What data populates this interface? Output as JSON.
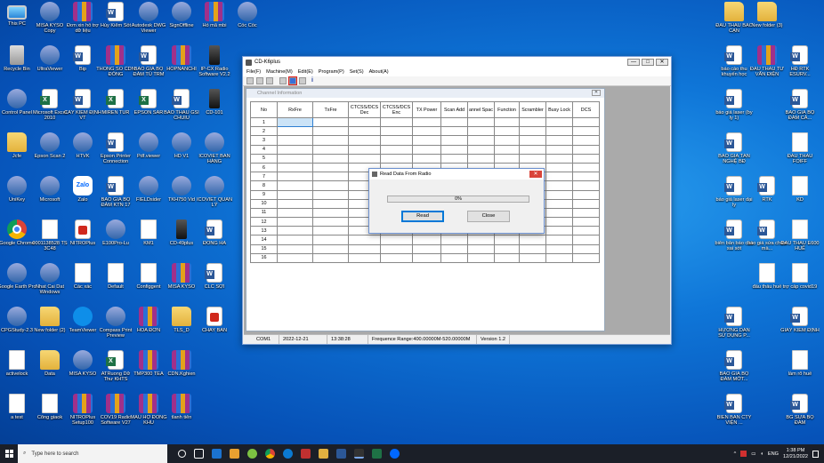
{
  "desktop": {
    "left_icons": [
      [
        {
          "label": "This PC",
          "type": "pc"
        },
        {
          "label": "Recycle Bin",
          "type": "bin"
        },
        {
          "label": "Control Panel",
          "type": "app"
        },
        {
          "label": "Jcfe",
          "type": "folder"
        },
        {
          "label": "UniKey",
          "type": "app"
        },
        {
          "label": "Google Chrome",
          "type": "chrome"
        },
        {
          "label": "Google Earth Pro",
          "type": "app"
        },
        {
          "label": "CPGStudy-2.3",
          "type": "app"
        },
        {
          "label": "activelock",
          "type": "doc"
        },
        {
          "label": "a test",
          "type": "doc"
        }
      ],
      [
        {
          "label": "MISA KYSO Copy",
          "type": "app"
        },
        {
          "label": "UltraViewer",
          "type": "app"
        },
        {
          "label": "Microsoft Excel 2010",
          "type": "excel"
        },
        {
          "label": "Epson Scan 2",
          "type": "app"
        },
        {
          "label": "Microsoft",
          "type": "app"
        },
        {
          "label": "0001138528 TS 3C48",
          "type": "doc"
        },
        {
          "label": "Nhat Cai Dat Windows",
          "type": "app"
        },
        {
          "label": "New folder (2)",
          "type": "folder"
        },
        {
          "label": "Data",
          "type": "folder"
        },
        {
          "label": "Cổng giaok",
          "type": "doc"
        }
      ],
      [
        {
          "label": "Đơn xin hỗ trợ dữ liệu",
          "type": "rar"
        },
        {
          "label": "Bip",
          "type": "word"
        },
        {
          "label": "CÁY KIỂM ĐỊNH VT",
          "type": "word"
        },
        {
          "label": "HTVK",
          "type": "app"
        },
        {
          "label": "Zalo",
          "type": "zalo"
        },
        {
          "label": "NITROPlus",
          "type": "pdf"
        },
        {
          "label": "Các xác",
          "type": "doc"
        },
        {
          "label": "TeamViewer",
          "type": "teamviewer"
        },
        {
          "label": "MISA KYSO",
          "type": "app"
        },
        {
          "label": "NITROPlus Setup100",
          "type": "rar"
        }
      ],
      [
        {
          "label": "Hủy Kiểm Sốt",
          "type": "word"
        },
        {
          "label": "THÔNG SỐ CDN ĐÓNG",
          "type": "rar"
        },
        {
          "label": "MIREN TUR",
          "type": "excel"
        },
        {
          "label": "Epson Printer Connection",
          "type": "word"
        },
        {
          "label": "BẢO GIÁ BỘ ĐÀM KTN 17",
          "type": "word"
        },
        {
          "label": "E100Pro-Lu",
          "type": "app"
        },
        {
          "label": "Default",
          "type": "doc"
        },
        {
          "label": "Compass Print Preview",
          "type": "app"
        },
        {
          "label": "ATRuong Dữ Thư KHTS",
          "type": "excel"
        },
        {
          "label": "COV19 Radio Software V27",
          "type": "rar"
        }
      ],
      [
        {
          "label": "Autodesk DWG Viewer",
          "type": "app"
        },
        {
          "label": "BẢO GIÁ BỘ ĐÀM TÙ TRM",
          "type": "word"
        },
        {
          "label": "EPSON SAR",
          "type": "excel"
        },
        {
          "label": "Pdf.viewer",
          "type": "app"
        },
        {
          "label": "FIELDsider",
          "type": "app"
        },
        {
          "label": "KM1",
          "type": "doc"
        },
        {
          "label": "Configgent",
          "type": "doc"
        },
        {
          "label": "HOA ĐƠN",
          "type": "rar"
        },
        {
          "label": "TMP300 TEA",
          "type": "rar"
        },
        {
          "label": "MẪU HỢ ĐỒNG KHU",
          "type": "rar"
        }
      ],
      [
        {
          "label": "SignOffline",
          "type": "app"
        },
        {
          "label": "HOPNANCHI",
          "type": "rar"
        },
        {
          "label": "BẢO THẦU GSI CHUIU",
          "type": "word"
        },
        {
          "label": "HD V1",
          "type": "app"
        },
        {
          "label": "TKH750 Vid",
          "type": "app"
        },
        {
          "label": "CD-49plus",
          "type": "radio"
        },
        {
          "label": "MISA KYSO",
          "type": "rar"
        },
        {
          "label": "TLS_D",
          "type": "folder"
        },
        {
          "label": "CDN.Kghien",
          "type": "rar"
        },
        {
          "label": "tlanh tiên",
          "type": "rar"
        }
      ],
      [
        {
          "label": "Hỏ mã mbi",
          "type": "rar"
        },
        {
          "label": "IP-CX Radio Software V2.2",
          "type": "radio"
        },
        {
          "label": "CD-101",
          "type": "radio"
        },
        {
          "label": "ICOVIET BẢN HÀNG",
          "type": "app"
        },
        {
          "label": "ICOVIET QUẢN LÝ",
          "type": "app"
        },
        {
          "label": "ĐỒNG HÀ",
          "type": "word"
        },
        {
          "label": "CLC SỢI",
          "type": "word"
        },
        {
          "label": "CHAY BẢN",
          "type": "pdf"
        },
        {
          "label": "",
          "type": "none"
        },
        {
          "label": "",
          "type": "none"
        }
      ],
      [
        {
          "label": "Cốc Cốc",
          "type": "app"
        }
      ]
    ],
    "right_icons": [
      [
        {
          "label": "ĐẦU THẦU BẮC CẠN",
          "type": "folder"
        },
        {
          "label": "báo cáo thu khuyến học",
          "type": "word"
        },
        {
          "label": "báo giá laser (by ly 1)",
          "type": "word"
        },
        {
          "label": "BẢO GIÁ TÂN NGHỆ BĐ",
          "type": "word"
        },
        {
          "label": "báo giá laser dại ly",
          "type": "word"
        },
        {
          "label": "biên bản báo cáo sai sót",
          "type": "word"
        },
        {
          "label": "",
          "type": "none"
        },
        {
          "label": "HƯỚNG DẪN SỬ DỤNG P...",
          "type": "word"
        },
        {
          "label": "BÁO GIÁ BỘ ĐÀM MỚT...",
          "type": "word"
        },
        {
          "label": "BIÊN BẢN CTY VIỆN ...",
          "type": "word"
        }
      ],
      [
        {
          "label": "New folder (3)",
          "type": "folder"
        },
        {
          "label": "ĐẦU THẦU TƯ VẤN ĐIỆN",
          "type": "rar"
        },
        {
          "label": "",
          "type": "none"
        },
        {
          "label": "",
          "type": "none"
        },
        {
          "label": "RTK",
          "type": "word"
        },
        {
          "label": "báo giá sửa chữa mà...",
          "type": "word"
        },
        {
          "label": "đấu thầu huế",
          "type": "doc"
        },
        {
          "label": "",
          "type": "none"
        },
        {
          "label": "",
          "type": "none"
        },
        {
          "label": "",
          "type": "none"
        }
      ],
      [
        {
          "label": "",
          "type": "none"
        },
        {
          "label": "HĐ RTK ESURV...",
          "type": "word"
        },
        {
          "label": "BÁO GIÁ BỘ ĐÀM CẢ...",
          "type": "word"
        },
        {
          "label": "ĐẤU THẦU FOIFF",
          "type": "doc"
        },
        {
          "label": "KD",
          "type": "doc"
        },
        {
          "label": "ĐẤU THẦU E600 HUẾ",
          "type": "doc"
        },
        {
          "label": "trợ cấp covid19",
          "type": "doc"
        },
        {
          "label": "GIẤY KIỂM ĐỊNH",
          "type": "word"
        },
        {
          "label": "làm rõ huế",
          "type": "doc"
        },
        {
          "label": "BG SỬA BỘ ĐÀM",
          "type": "word"
        }
      ]
    ]
  },
  "app": {
    "title": "CD-K6plus",
    "menu": [
      "File(F)",
      "Machine(M)",
      "Edit(E)",
      "Program(P)",
      "Set(S)",
      "About(A)"
    ],
    "window_buttons": [
      "—",
      "□",
      "✕"
    ],
    "child_title": "Channel Information",
    "columns": [
      "No",
      "RxFre",
      "TxFre",
      "CTCSS/DCS Dec",
      "CTCSS/DCS Enc",
      "TX Power",
      "Scan Add",
      "annel Spac",
      "Function",
      "Scrambler",
      "Busy Lock",
      "DCS"
    ],
    "rows": [
      "1",
      "2",
      "3",
      "4",
      "5",
      "6",
      "7",
      "8",
      "9",
      "10",
      "11",
      "12",
      "13",
      "14",
      "15",
      "16"
    ],
    "status": {
      "port": "COM1",
      "date": "2022-12-21",
      "time": "13:38:28",
      "range": "Frequence Range:400.00000M-520.00000M",
      "version": "Version 1.2"
    }
  },
  "dialog": {
    "title": "Read Data From Radio",
    "progress_text": "0%",
    "progress_value": 0,
    "read_label": "Read",
    "close_label": "Close"
  },
  "taskbar": {
    "search_placeholder": "Type here to search",
    "lang": "ENG",
    "time": "1:38 PM",
    "date": "12/21/2022"
  },
  "colors": {
    "accent": "#0078d7",
    "progress": "#06b025",
    "highlight": "#e02020"
  }
}
